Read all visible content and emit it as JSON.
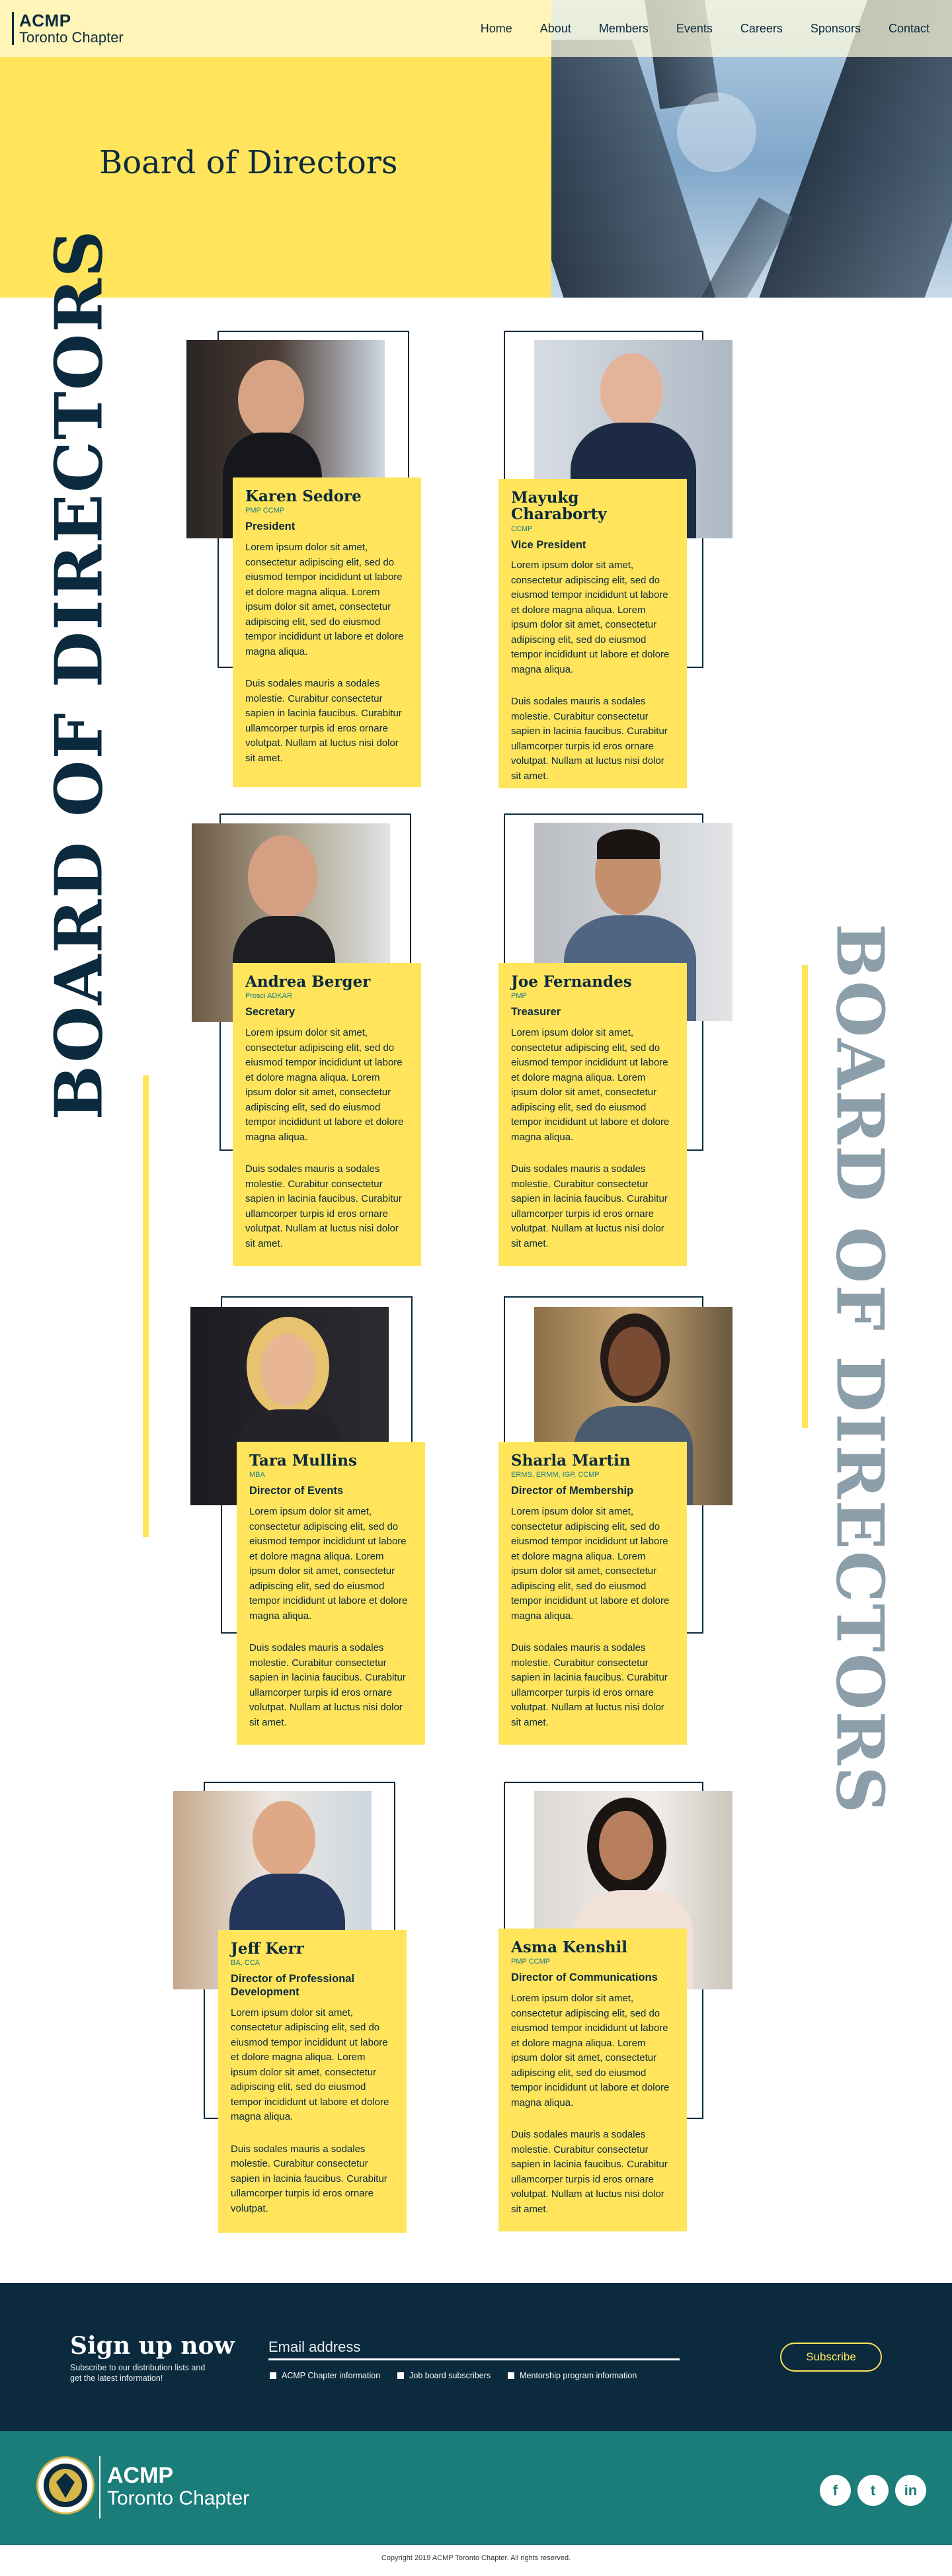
{
  "nav": {
    "brand_line1": "ACMP",
    "brand_line2": "Toronto Chapter",
    "items": [
      "Home",
      "About",
      "Members",
      "Events",
      "Careers",
      "Sponsors",
      "Contact"
    ]
  },
  "hero": {
    "title": "Board of Directors"
  },
  "board": {
    "vertical_text": "BOARD OF DIRECTORS",
    "members": [
      {
        "name": "Karen Sedore",
        "credentials": "PMP CCMP",
        "role": "President",
        "bio1": "Lorem ipsum dolor sit amet, consectetur adipiscing elit, sed do eiusmod tempor incididunt ut labore et dolore magna aliqua. Lorem ipsum dolor sit amet, consectetur adipiscing elit, sed do eiusmod tempor incididunt ut labore et dolore magna aliqua.",
        "bio2": "Duis sodales mauris a sodales molestie. Curabitur consectetur sapien in lacinia faucibus. Curabitur ullamcorper turpis id eros ornare volutpat. Nullam at luctus nisi dolor sit amet."
      },
      {
        "name": "Mayukg Charaborty",
        "credentials": "CCMP",
        "role": "Vice President",
        "bio1": "Lorem ipsum dolor sit amet, consectetur adipiscing elit, sed do eiusmod tempor incididunt ut labore et dolore magna aliqua. Lorem ipsum dolor sit amet, consectetur adipiscing elit, sed do eiusmod tempor incididunt ut labore et dolore magna aliqua.",
        "bio2": "Duis sodales mauris a sodales molestie. Curabitur consectetur sapien in lacinia faucibus. Curabitur ullamcorper turpis id eros ornare volutpat. Nullam at luctus nisi dolor sit amet."
      },
      {
        "name": "Andrea Berger",
        "credentials": "Prosci ADKAR",
        "role": "Secretary",
        "bio1": "Lorem ipsum dolor sit amet, consectetur adipiscing elit, sed do eiusmod tempor incididunt ut labore et dolore magna aliqua. Lorem ipsum dolor sit amet, consectetur adipiscing elit, sed do eiusmod tempor incididunt ut labore et dolore magna aliqua.",
        "bio2": "Duis sodales mauris a sodales molestie. Curabitur consectetur sapien in lacinia faucibus. Curabitur ullamcorper turpis id eros ornare volutpat. Nullam at luctus nisi dolor sit amet."
      },
      {
        "name": "Joe Fernandes",
        "credentials": "PMP",
        "role": "Treasurer",
        "bio1": "Lorem ipsum dolor sit amet, consectetur adipiscing elit, sed do eiusmod tempor incididunt ut labore et dolore magna aliqua. Lorem ipsum dolor sit amet, consectetur adipiscing elit, sed do eiusmod tempor incididunt ut labore et dolore magna aliqua.",
        "bio2": "Duis sodales mauris a sodales molestie. Curabitur consectetur sapien in lacinia faucibus. Curabitur ullamcorper turpis id eros ornare volutpat. Nullam at luctus nisi dolor sit amet."
      },
      {
        "name": "Tara Mullins",
        "credentials": "MBA",
        "role": "Director of Events",
        "bio1": "Lorem ipsum dolor sit amet, consectetur adipiscing elit, sed do eiusmod tempor incididunt ut labore et dolore magna aliqua. Lorem ipsum dolor sit amet, consectetur adipiscing elit, sed do eiusmod tempor incididunt ut labore et dolore magna aliqua.",
        "bio2": "Duis sodales mauris a sodales molestie. Curabitur consectetur sapien in lacinia faucibus. Curabitur ullamcorper turpis id eros ornare volutpat. Nullam at luctus nisi dolor sit amet."
      },
      {
        "name": "Sharla Martin",
        "credentials": "ERMS, ERMM, IGP, CCMP",
        "role": "Director of Membership",
        "bio1": "Lorem ipsum dolor sit amet, consectetur adipiscing elit, sed do eiusmod tempor incididunt ut labore et dolore magna aliqua. Lorem ipsum dolor sit amet, consectetur adipiscing elit, sed do eiusmod tempor incididunt ut labore et dolore magna aliqua.",
        "bio2": "Duis sodales mauris a sodales molestie. Curabitur consectetur sapien in lacinia faucibus. Curabitur ullamcorper turpis id eros ornare volutpat. Nullam at luctus nisi dolor sit amet."
      },
      {
        "name": "Jeff Kerr",
        "credentials": "BA, CCA",
        "role": "Director of Professional Development",
        "bio1": "Lorem ipsum dolor sit amet, consectetur adipiscing elit, sed do eiusmod tempor incididunt ut labore et dolore magna aliqua. Lorem ipsum dolor sit amet, consectetur adipiscing elit, sed do eiusmod tempor incididunt ut labore et dolore magna aliqua.",
        "bio2": "Duis sodales mauris a sodales molestie. Curabitur consectetur sapien in lacinia faucibus. Curabitur ullamcorper turpis id eros ornare volutpat."
      },
      {
        "name": "Asma Kenshil",
        "credentials": "PMP CCMP",
        "role": "Director of Communications",
        "bio1": "Lorem ipsum dolor sit amet, consectetur adipiscing elit, sed do eiusmod tempor incididunt ut labore et dolore magna aliqua. Lorem ipsum dolor sit amet, consectetur adipiscing elit, sed do eiusmod tempor incididunt ut labore et dolore magna aliqua.",
        "bio2": "Duis sodales mauris a sodales molestie. Curabitur consectetur sapien in lacinia faucibus. Curabitur ullamcorper turpis id eros ornare volutpat. Nullam at luctus nisi dolor sit amet."
      }
    ]
  },
  "signup": {
    "title": "Sign up now",
    "subtitle": "Subscribe to our distribution lists and get the latest information!",
    "email_placeholder": "Email address",
    "checkboxes": [
      "ACMP Chapter information",
      "Job board subscribers",
      "Mentorship program information"
    ],
    "button": "Subscribe"
  },
  "footer": {
    "brand_line1": "ACMP",
    "brand_line2": "Toronto Chapter",
    "socials": [
      {
        "icon": "facebook-icon",
        "glyph": "f"
      },
      {
        "icon": "twitter-icon",
        "glyph": "t"
      },
      {
        "icon": "linkedin-icon",
        "glyph": "in"
      }
    ],
    "copyright": "Copyright 2019 ACMP Toronto Chapter. All rights reserved."
  },
  "colors": {
    "accent_yellow": "#ffe45c",
    "navy": "#0b2a3d",
    "teal": "#1a7d7a",
    "credential_teal": "#1b7d8a",
    "vertical_grey": "#8b9ea9"
  }
}
